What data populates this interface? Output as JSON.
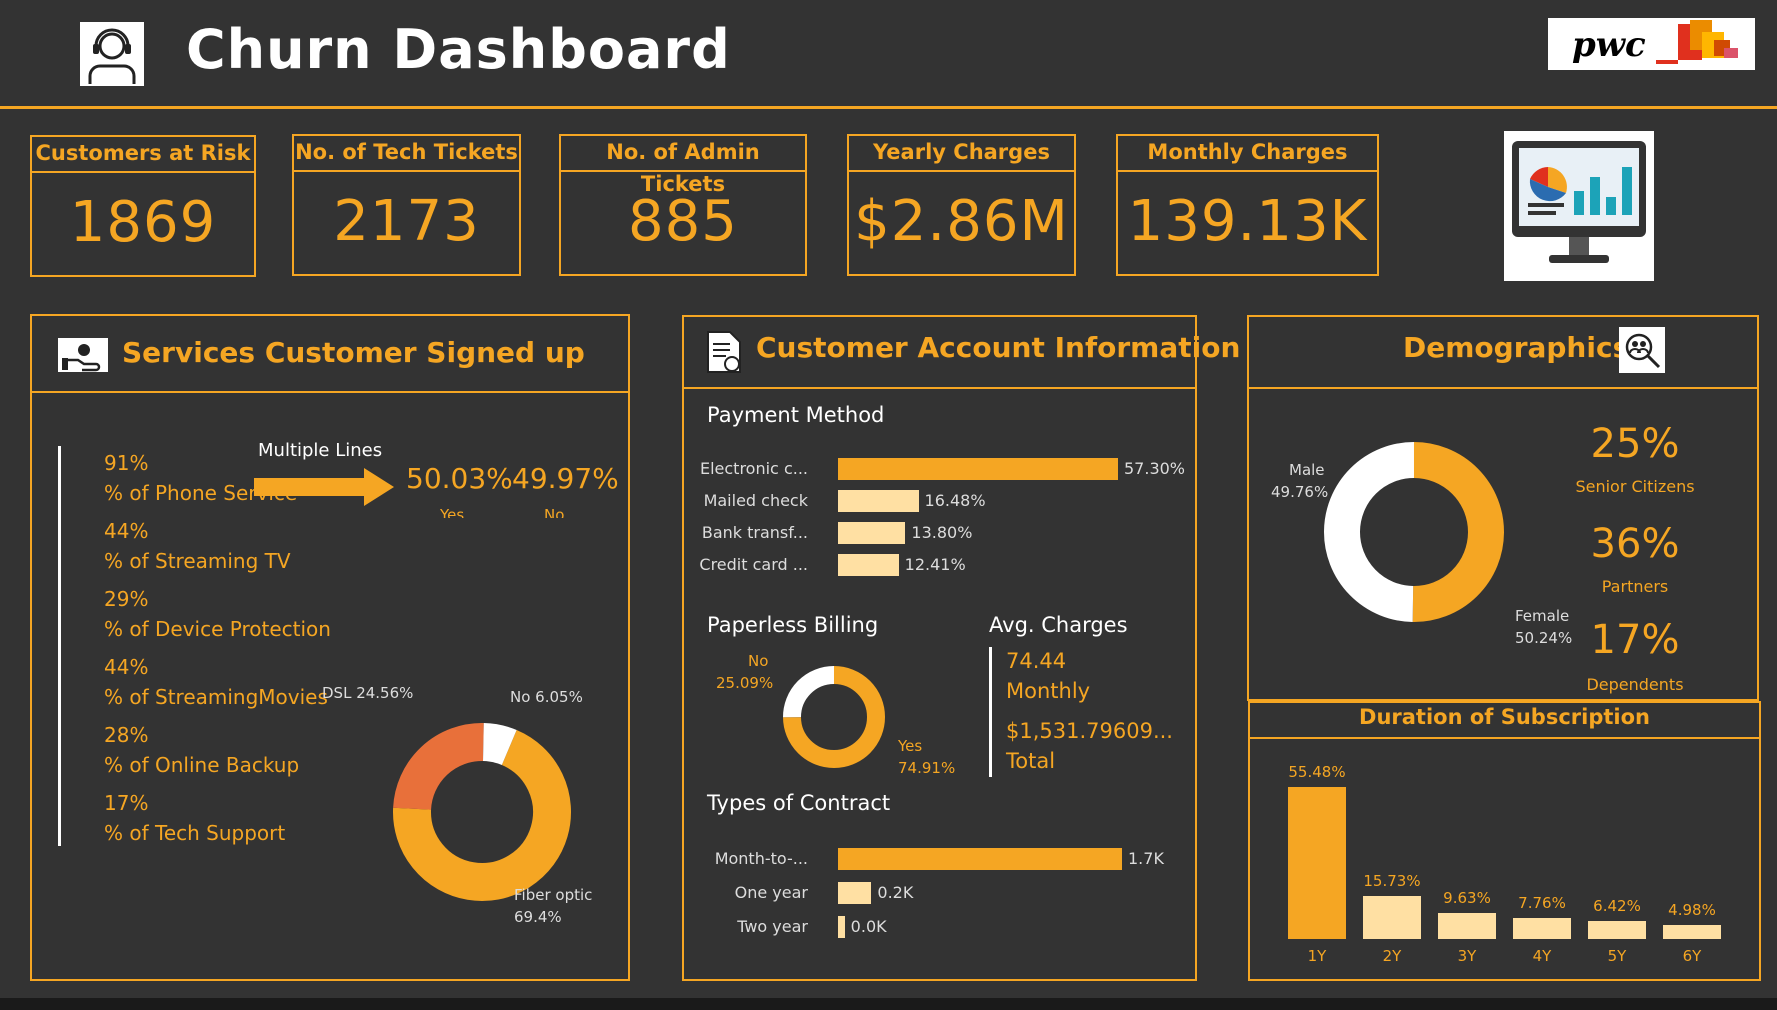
{
  "header": {
    "title": "Churn Dashboard",
    "logo_text": "pwc",
    "accent": "#F5A623"
  },
  "kpis": [
    {
      "label": "Customers at Risk",
      "value": "1869"
    },
    {
      "label": "No. of Tech Tickets",
      "value": "2173"
    },
    {
      "label": "No. of Admin Tickets",
      "value": "885"
    },
    {
      "label": "Yearly Charges",
      "value": "$2.86M"
    },
    {
      "label": "Monthly Charges",
      "value": "139.13K"
    }
  ],
  "services": {
    "title": "Services Customer Signed up",
    "items": [
      {
        "pct": "91%",
        "label": "% of Phone Service"
      },
      {
        "pct": "44%",
        "label": "% of Streaming TV"
      },
      {
        "pct": "29%",
        "label": "% of Device Protection"
      },
      {
        "pct": "44%",
        "label": "% of StreamingMovies"
      },
      {
        "pct": "28%",
        "label": "% of Online Backup"
      },
      {
        "pct": "17%",
        "label": "% of Tech Support"
      }
    ],
    "multiple_lines": {
      "label": "Multiple Lines",
      "yes_value": "50.03%",
      "no_value": "49.97%",
      "yes_label": "Yes",
      "no_label": "No"
    },
    "internet_donut": {
      "slices": [
        {
          "name": "Fiber optic",
          "value": 69.4,
          "label": "Fiber optic",
          "pct_label": "69.4%",
          "color": "#F5A623"
        },
        {
          "name": "DSL",
          "value": 24.56,
          "label": "DSL 24.56%",
          "color": "#E8703A"
        },
        {
          "name": "No",
          "value": 6.05,
          "label": "No 6.05%",
          "color": "#FFFFFF"
        }
      ]
    }
  },
  "account": {
    "title": "Customer Account Information",
    "payment_method": {
      "title": "Payment Method",
      "bars": [
        {
          "label": "Electronic c...",
          "value": 57.3,
          "text": "57.30%",
          "color": "#F5A623"
        },
        {
          "label": "Mailed check",
          "value": 16.48,
          "text": "16.48%",
          "color": "#FFE0A3"
        },
        {
          "label": "Bank transf...",
          "value": 13.8,
          "text": "13.80%",
          "color": "#FFE0A3"
        },
        {
          "label": "Credit card ...",
          "value": 12.41,
          "text": "12.41%",
          "color": "#FFE0A3"
        }
      ]
    },
    "paperless": {
      "title": "Paperless Billing",
      "no_label": "No",
      "no_pct": "25.09%",
      "yes_label": "Yes",
      "yes_pct": "74.91%",
      "yes_value": 74.91
    },
    "avg_charges": {
      "title": "Avg. Charges",
      "monthly_value": "74.44",
      "monthly_label": "Monthly",
      "total_value": "$1,531.79609...",
      "total_label": "Total"
    },
    "contract": {
      "title": "Types of Contract",
      "bars": [
        {
          "label": "Month-to-...",
          "value": 1.7,
          "text": "1.7K",
          "color": "#F5A623"
        },
        {
          "label": "One year",
          "value": 0.2,
          "text": "0.2K",
          "color": "#FFE0A3"
        },
        {
          "label": "Two year",
          "value": 0.04,
          "text": "0.0K",
          "color": "#FFE0A3"
        }
      ]
    }
  },
  "demographics": {
    "title": "Demographics",
    "gender_donut": {
      "male_label": "Male",
      "male_pct": "49.76%",
      "female_label": "Female",
      "female_pct": "50.24%",
      "female_value": 50.24
    },
    "stats": [
      {
        "value": "25%",
        "label": "Senior Citizens"
      },
      {
        "value": "36%",
        "label": "Partners"
      },
      {
        "value": "17%",
        "label": "Dependents"
      }
    ]
  },
  "duration": {
    "title": "Duration of Subscription",
    "bars": [
      {
        "cat": "1Y",
        "value": 55.48,
        "text": "55.48%"
      },
      {
        "cat": "2Y",
        "value": 15.73,
        "text": "15.73%"
      },
      {
        "cat": "3Y",
        "value": 9.63,
        "text": "9.63%"
      },
      {
        "cat": "4Y",
        "value": 7.76,
        "text": "7.76%"
      },
      {
        "cat": "5Y",
        "value": 6.42,
        "text": "6.42%"
      },
      {
        "cat": "6Y",
        "value": 4.98,
        "text": "4.98%"
      }
    ]
  }
}
